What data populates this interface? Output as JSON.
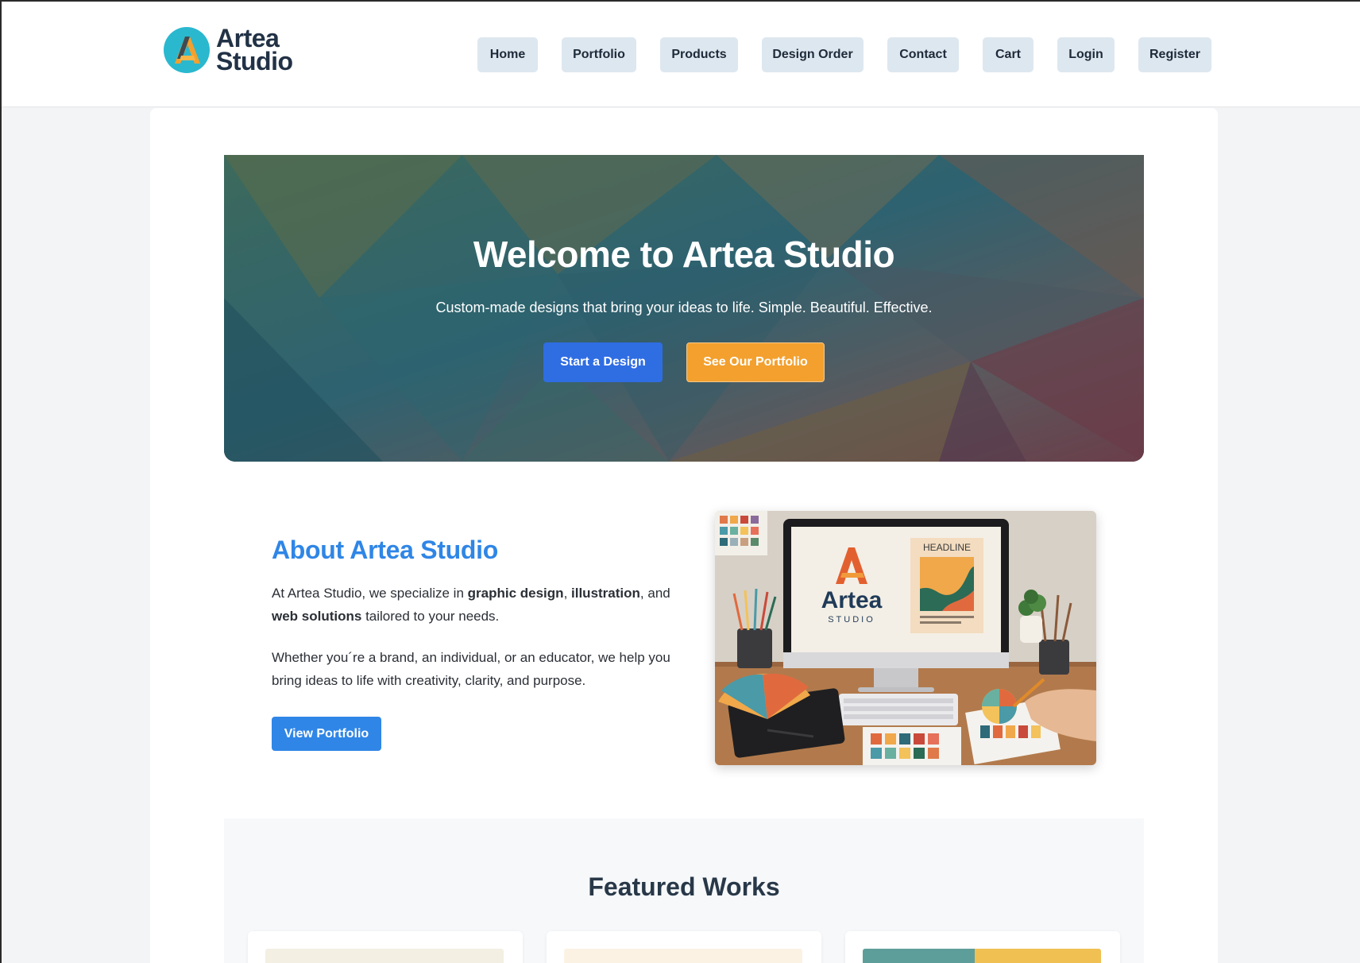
{
  "brand": {
    "name_line1": "Artea",
    "name_line2": "Studio",
    "accent": "#2ab8cf",
    "orange": "#f3a02e"
  },
  "nav": {
    "items": [
      {
        "label": "Home"
      },
      {
        "label": "Portfolio"
      },
      {
        "label": "Products"
      },
      {
        "label": "Design Order"
      },
      {
        "label": "Contact"
      },
      {
        "label": "Cart"
      },
      {
        "label": "Login"
      },
      {
        "label": "Register"
      }
    ]
  },
  "hero": {
    "title": "Welcome to Artea Studio",
    "subtitle": "Custom-made designs that bring your ideas to life. Simple. Beautiful. Effective.",
    "primary_button": "Start a Design",
    "secondary_button": "See Our Portfolio"
  },
  "about": {
    "title": "About Artea Studio",
    "p1_intro": "At Artea Studio, we specialize in ",
    "p1_b1": "graphic design",
    "p1_sep": ", ",
    "p1_b2": "illustration",
    "p1_and": ", and ",
    "p1_b3": "web solutions",
    "p1_end": " tailored to your needs.",
    "p2": "Whether you´re a brand, an individual, or an educator, we help you bring ideas to life with creativity, clarity, and purpose.",
    "button": "View Portfolio",
    "image": {
      "screen_logo_line1": "Artea",
      "screen_logo_line2": "STUDIO",
      "poster_label": "HEADLINE"
    }
  },
  "featured": {
    "title": "Featured Works"
  },
  "colors": {
    "primary_blue": "#2f6de3",
    "link_blue": "#2f86e6",
    "nav_bg": "#dde7ef"
  }
}
